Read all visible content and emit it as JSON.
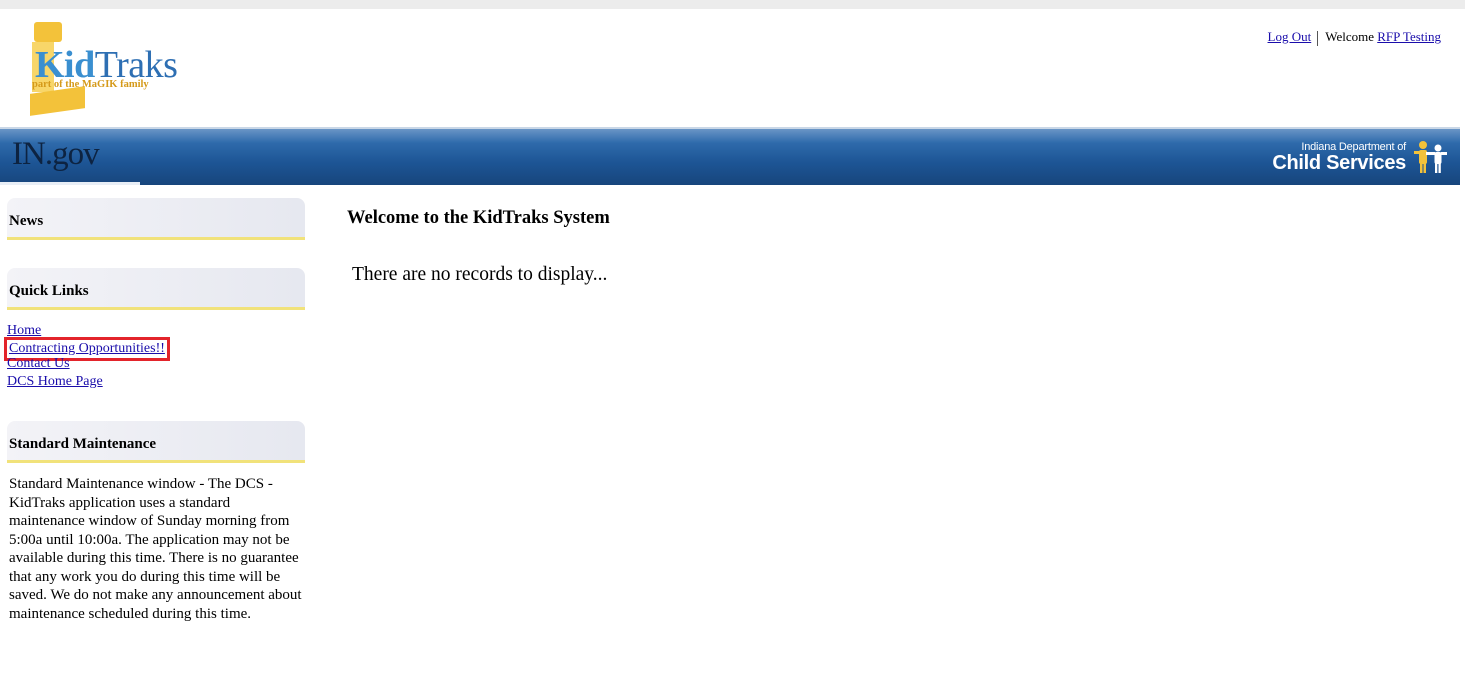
{
  "logo": {
    "part1": "Kid",
    "part2": "Traks",
    "tagline": "part of the MaGIK family"
  },
  "user_bar": {
    "logout": "Log Out",
    "welcome": "Welcome",
    "username": "RFP Testing"
  },
  "banner": {
    "left_text": "IN.gov",
    "right_line1": "Indiana Department of",
    "right_line2": "Child Services"
  },
  "sidebar": {
    "news_title": "News",
    "quick_links_title": "Quick Links",
    "quick_links": [
      "Home",
      "Contracting Opportunities!!",
      "Contact Us",
      "DCS Home Page"
    ],
    "maintenance_title": "Standard Maintenance",
    "maintenance_text": "Standard Maintenance window - The DCS - KidTraks application uses a standard maintenance window of Sunday morning from 5:00a until 10:00a. The application may not be available during this time. There is no guarantee that any work you do during this time will be saved. We do not make any announcement about maintenance scheduled during this time."
  },
  "main": {
    "title": "Welcome to the KidTraks System",
    "empty_message": "There are no records to display..."
  },
  "colors": {
    "highlight": "#e3242b",
    "link": "#1a0dab",
    "banner": "#1d5595"
  }
}
